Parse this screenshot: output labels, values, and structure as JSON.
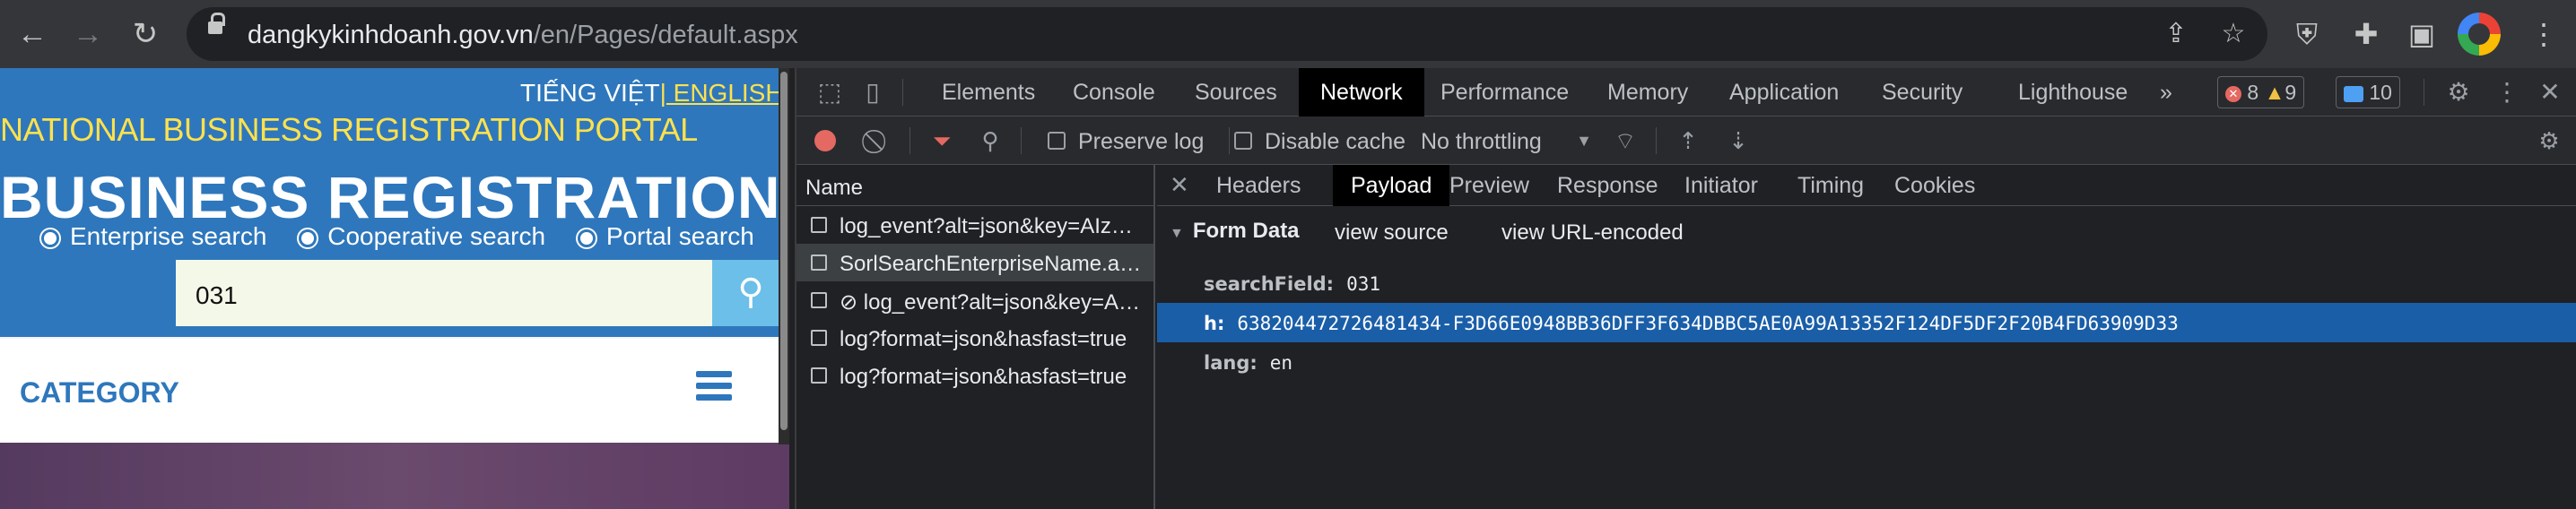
{
  "browser": {
    "url_domain": "dangkykinhdoanh.gov.vn",
    "url_path": "/en/Pages/default.aspx"
  },
  "site": {
    "lang_vi": "TIẾNG VIỆT",
    "lang_sep": "|",
    "lang_en": " ENGLISH",
    "portal_title": "NATIONAL BUSINESS REGISTRATION PORTAL",
    "main_title": "BUSINESS REGISTRATION",
    "radios": [
      "Enterprise search",
      "Cooperative search",
      "Portal search"
    ],
    "search_value": "031",
    "category": "CATEGORY"
  },
  "devtools": {
    "tabs": [
      "Elements",
      "Console",
      "Sources",
      "Network",
      "Performance",
      "Memory",
      "Application",
      "Security",
      "Lighthouse"
    ],
    "active_tab": "Network",
    "more": "»",
    "errors": "8",
    "warnings": "9",
    "messages": "10",
    "toolbar": {
      "preserve_log": "Preserve log",
      "disable_cache": "Disable cache",
      "throttling": "No throttling"
    },
    "requests_header": "Name",
    "requests": [
      "log_event?alt=json&key=AIzaSy",
      "SorlSearchEnterpriseName.aspx",
      "log_event?alt=json&key=AIzaSy",
      "log?format=json&hasfast=true",
      "log?format=json&hasfast=true"
    ],
    "detail_tabs": [
      "Headers",
      "Payload",
      "Preview",
      "Response",
      "Initiator",
      "Timing",
      "Cookies"
    ],
    "active_detail_tab": "Payload",
    "form_data_label": "Form Data",
    "view_source": "view source",
    "view_url_encoded": "view URL-encoded",
    "form_data": [
      {
        "key": "searchField:",
        "value": "031"
      },
      {
        "key": "h:",
        "value": "638204472726481434-F3D66E0948BB36DFF3F634DBBC5AE0A99A13352F124DF5DF2F20B4FD63909D33"
      },
      {
        "key": "lang:",
        "value": "en"
      }
    ]
  }
}
